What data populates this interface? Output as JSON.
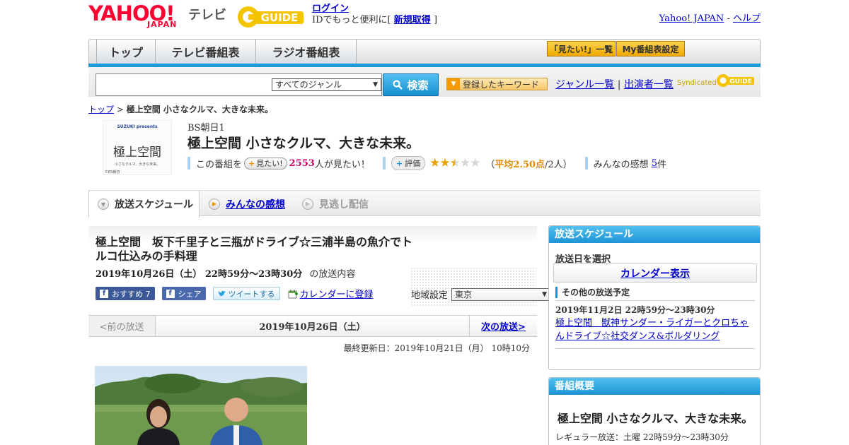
{
  "header": {
    "logo_yahoo": "YAHOO!",
    "logo_japan": "JAPAN",
    "logo_tv": "テレビ",
    "gguide_logo": "GUIDE",
    "login": "ログイン",
    "id_text_pre": "IDでもっと便利に[",
    "register": "新規取得",
    "id_text_post": "]",
    "yahoo_japan_link": "Yahoo! JAPAN",
    "link_sep": "-",
    "help_link": "ヘルプ"
  },
  "nav": {
    "tabs": [
      "トップ",
      "テレビ番組表",
      "ラジオ番組表"
    ],
    "want_list": "「見たい!」一覧",
    "my_schedule": "My番組表設定"
  },
  "search": {
    "genre_selected": "すべてのジャンル",
    "button": "検索",
    "keyword_button": "登録したキーワード",
    "genre_list": "ジャンル一覧",
    "sep": "|",
    "performer_list": "出演者一覧",
    "syndicated": "Syndicated",
    "gguide_small": "GUIDE"
  },
  "breadcrumb": {
    "top": "トップ",
    "arrow": ">",
    "current": "極上空間 小さなクルマ、大きな未来。"
  },
  "program": {
    "thumb_sponsor": "SUZUKI presents",
    "thumb_title": "極上空間",
    "thumb_sub": "小さなクルマ、大きな未来。",
    "thumb_credit": "©BS朝日",
    "channel": "BS朝日1",
    "title": "極上空間 小さなクルマ、大きな未来。",
    "this_program": "この番組を",
    "want_button": "見たい!",
    "want_count": "2553",
    "want_suffix": "人が見たい！",
    "rate_button": "評価",
    "rating": 2.5,
    "avg_open": "（",
    "avg_label": "平均2.50点",
    "avg_rest": "/2人）",
    "impressions_label": "みんなの感想",
    "impressions_count": "5",
    "impressions_suffix": "件"
  },
  "tabs": {
    "schedule": "放送スケジュール",
    "impressions": "みんなの感想",
    "missed": "見逃し配信"
  },
  "episode": {
    "title": "極上空間　坂下千里子と三瓶がドライブ☆三浦半島の魚介でトルコ仕込みの手料理",
    "date": "2019年10月26日（土）  22時59分～23時30分",
    "date_suffix": "の放送内容",
    "fb_recommend": "おすすめ 7",
    "fb_share": "シェア",
    "tweet": "ツイートする",
    "calendar_register": "カレンダーに登録",
    "region_label": "地域設定",
    "region_value": "東京"
  },
  "pager": {
    "prev": "<前の放送",
    "date": "2019年10月26日（土）",
    "next": "次の放送>"
  },
  "updated": "最終更新日：2019年10月21日（月）  10時10分",
  "sidebar": {
    "schedule_head": "放送スケジュール",
    "select_date": "放送日を選択",
    "calendar_button": "カレンダー表示",
    "other_head": "その他の放送予定",
    "other_date": "2019年11月2日  22時59分～23時30分",
    "other_title": "極上空間　獣神サンダー・ライガーとクロちゃんドライブ☆社交ダンス&ボルダリング",
    "summary_head": "番組概要",
    "summary_title": "極上空間 小さなクルマ、大きな未来。",
    "regular": "レギュラー放送：土曜 22時59分～23時30分"
  },
  "colors": {
    "accent_blue": "#1b9ad8",
    "yahoo_red": "#ff0033",
    "gguide_yellow": "#f5c400",
    "want_count": "#cc0066"
  }
}
